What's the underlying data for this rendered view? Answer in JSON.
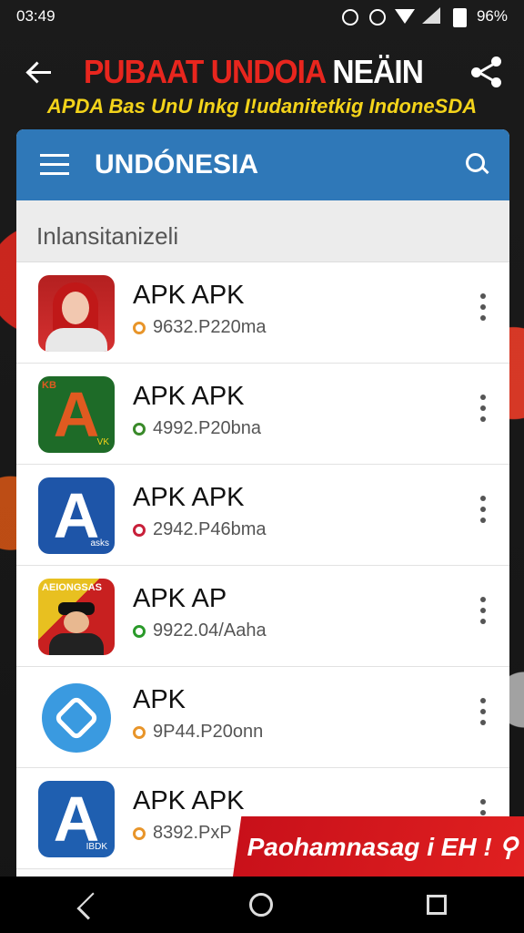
{
  "status_bar": {
    "time": "03:49",
    "battery": "96%"
  },
  "header": {
    "title_red": "PUBAAT UNDOIA",
    "title_white": "NEÄIN",
    "subtitle": "APDA Bas UnU Inkg I!udanitetkig IndoneSDA"
  },
  "toolbar": {
    "title": "UNDÓNESIA"
  },
  "section": {
    "label": "Inlansitanizeli"
  },
  "apps": [
    {
      "name": "APK APK",
      "meta": "9632.P220ma",
      "dot_color": "#e8952a",
      "icon": "woman-hijab-icon"
    },
    {
      "name": "APK APK",
      "meta": "4992.P20bna",
      "dot_color": "#3a8a2a",
      "icon": "letter-a-green-icon",
      "icon_tl": "KB",
      "icon_br": "VK"
    },
    {
      "name": "APK APK",
      "meta": "2942.P46bma",
      "dot_color": "#c8203a",
      "icon": "letter-a-blue-icon",
      "icon_br": "asks"
    },
    {
      "name": "APK AP",
      "meta": "9922.04/Aaha",
      "dot_color": "#2a9a2a",
      "icon": "man-hat-icon",
      "icon_tl": "AEIONGSAS"
    },
    {
      "name": "APK",
      "meta": "9P44.P20onn",
      "dot_color": "#e8952a",
      "icon": "blue-flower-icon"
    },
    {
      "name": "APK APK",
      "meta": "8392.PxP",
      "dot_color": "#e8952a",
      "icon": "letter-a-white-icon",
      "icon_br": "IBDK"
    }
  ],
  "promo": {
    "text": "Paohamnasag i EH ! ⚲"
  }
}
